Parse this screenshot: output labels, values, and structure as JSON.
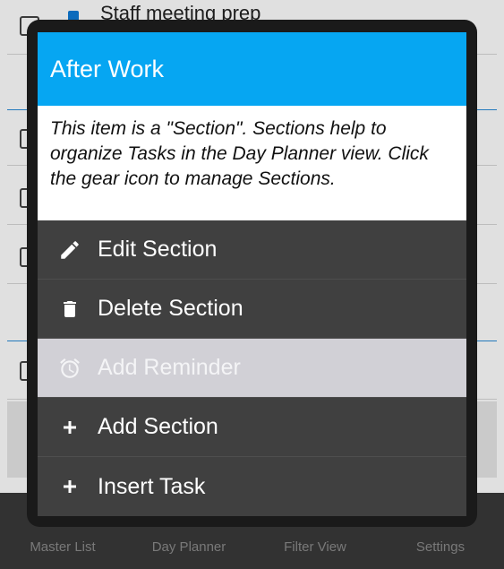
{
  "background": {
    "first_task_title": "Staff meeting prep",
    "tabs": [
      "Master List",
      "Day Planner",
      "Filter View",
      "Settings"
    ]
  },
  "dialog": {
    "title": "After Work",
    "description": "This item is a \"Section\". Sections help to organize Tasks in the Day Planner view. Click the gear icon to manage Sections.",
    "menu": [
      {
        "label": "Edit Section",
        "icon": "pencil-icon",
        "enabled": true
      },
      {
        "label": "Delete Section",
        "icon": "trash-icon",
        "enabled": true
      },
      {
        "label": "Add Reminder",
        "icon": "alarm-clock-icon",
        "enabled": false
      },
      {
        "label": "Add Section",
        "icon": "plus-icon",
        "enabled": true
      },
      {
        "label": "Insert Task",
        "icon": "plus-icon",
        "enabled": true
      }
    ]
  },
  "colors": {
    "header": "#06a6f2",
    "menu_bg": "#404040",
    "disabled_bg": "#d1d0d6"
  }
}
